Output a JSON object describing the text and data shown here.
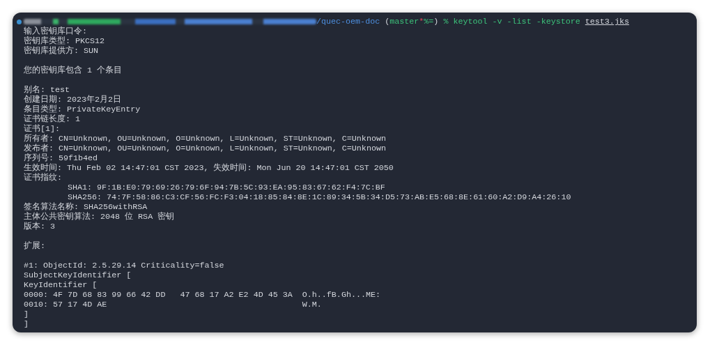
{
  "prompt": {
    "path": "/quec-oem-doc",
    "branch_open": "(",
    "branch": "master",
    "dirty_mark": "*",
    "status_mark": "%=",
    "branch_close": ")",
    "symbol": "%",
    "command": "keytool -v -list -keystore",
    "argument": "test3.jks"
  },
  "lines": [
    {
      "kind": "text",
      "text": "输入密钥库口令:"
    },
    {
      "kind": "text",
      "text": "密钥库类型: PKCS12"
    },
    {
      "kind": "text",
      "text": "密钥库提供方: SUN"
    },
    {
      "kind": "blank"
    },
    {
      "kind": "text",
      "text": "您的密钥库包含 1 个条目"
    },
    {
      "kind": "blank"
    },
    {
      "kind": "text",
      "text": "别名: test"
    },
    {
      "kind": "text",
      "text": "创建日期: 2023年2月2日"
    },
    {
      "kind": "text",
      "text": "条目类型: PrivateKeyEntry"
    },
    {
      "kind": "text",
      "text": "证书链长度: 1"
    },
    {
      "kind": "text",
      "text": "证书[1]:"
    },
    {
      "kind": "text",
      "text": "所有者: CN=Unknown, OU=Unknown, O=Unknown, L=Unknown, ST=Unknown, C=Unknown"
    },
    {
      "kind": "text",
      "text": "发布者: CN=Unknown, OU=Unknown, O=Unknown, L=Unknown, ST=Unknown, C=Unknown"
    },
    {
      "kind": "text",
      "text": "序列号: 59f1b4ed"
    },
    {
      "kind": "text",
      "text": "生效时间: Thu Feb 02 14:47:01 CST 2023, 失效时间: Mon Jun 20 14:47:01 CST 2050"
    },
    {
      "kind": "text",
      "text": "证书指纹:"
    },
    {
      "kind": "indented",
      "text": "SHA1: 9F:1B:E0:79:69:26:79:6F:94:7B:5C:93:EA:95:83:67:62:F4:7C:BF"
    },
    {
      "kind": "indented",
      "text": "SHA256: 74:7F:58:86:C3:CF:56:FC:F3:04:18:85:84:8E:1C:89:34:5B:34:D5:73:AB:E5:68:8E:61:60:A2:D9:A4:26:10"
    },
    {
      "kind": "text",
      "text": "签名算法名称: SHA256withRSA"
    },
    {
      "kind": "text",
      "text": "主体公共密钥算法: 2048 位 RSA 密钥"
    },
    {
      "kind": "text",
      "text": "版本: 3"
    },
    {
      "kind": "blank"
    },
    {
      "kind": "text",
      "text": "扩展:"
    },
    {
      "kind": "blank"
    },
    {
      "kind": "text",
      "text": "#1: ObjectId: 2.5.29.14 Criticality=false"
    },
    {
      "kind": "text",
      "text": "SubjectKeyIdentifier ["
    },
    {
      "kind": "text",
      "text": "KeyIdentifier ["
    },
    {
      "kind": "text",
      "text": "0000: 4F 7D 68 83 99 66 42 DD   47 68 17 A2 E2 4D 45 3A  O.h..fB.Gh...ME:"
    },
    {
      "kind": "text",
      "text": "0010: 57 17 4D AE                                        W.M."
    },
    {
      "kind": "text",
      "text": "]"
    },
    {
      "kind": "text",
      "text": "]"
    }
  ]
}
